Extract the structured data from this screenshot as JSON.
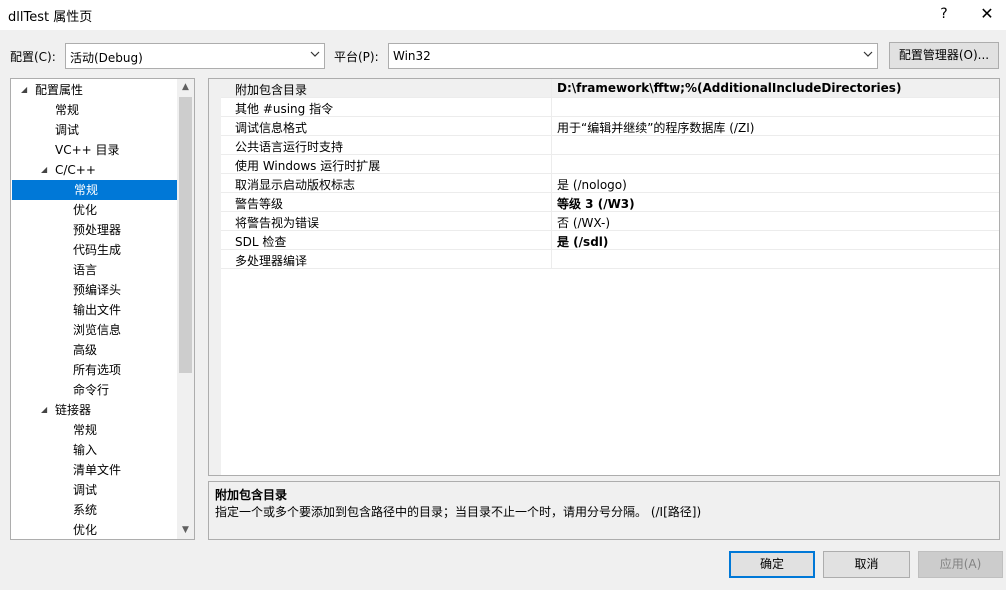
{
  "window": {
    "title": "dllTest 属性页",
    "help_label": "?",
    "close_label": "✕"
  },
  "config": {
    "label": "配置(C):",
    "value": "活动(Debug)"
  },
  "platform": {
    "label": "平台(P):",
    "value": "Win32"
  },
  "config_manager_label": "配置管理器(O)...",
  "tree": {
    "items": [
      {
        "label": "配置属性",
        "level": 0,
        "expanded": true
      },
      {
        "label": "常规",
        "level": 1
      },
      {
        "label": "调试",
        "level": 1
      },
      {
        "label": "VC++ 目录",
        "level": 1
      },
      {
        "label": "C/C++",
        "level": 1,
        "expanded": true
      },
      {
        "label": "常规",
        "level": 2,
        "selected": true
      },
      {
        "label": "优化",
        "level": 2
      },
      {
        "label": "预处理器",
        "level": 2
      },
      {
        "label": "代码生成",
        "level": 2
      },
      {
        "label": "语言",
        "level": 2
      },
      {
        "label": "预编译头",
        "level": 2
      },
      {
        "label": "输出文件",
        "level": 2
      },
      {
        "label": "浏览信息",
        "level": 2
      },
      {
        "label": "高级",
        "level": 2
      },
      {
        "label": "所有选项",
        "level": 2
      },
      {
        "label": "命令行",
        "level": 2
      },
      {
        "label": "链接器",
        "level": 1,
        "expanded": true
      },
      {
        "label": "常规",
        "level": 2
      },
      {
        "label": "输入",
        "level": 2
      },
      {
        "label": "清单文件",
        "level": 2
      },
      {
        "label": "调试",
        "level": 2
      },
      {
        "label": "系统",
        "level": 2
      },
      {
        "label": "优化",
        "level": 2
      }
    ],
    "expanded_arrow": "◢",
    "scroll_up": "▲",
    "scroll_down": "▼"
  },
  "properties": [
    {
      "name": "附加包含目录",
      "value": "D:\\framework\\fftw;%(AdditionalIncludeDirectories)",
      "bold": true,
      "selected": true
    },
    {
      "name": "其他 #using 指令",
      "value": ""
    },
    {
      "name": "调试信息格式",
      "value": "用于“编辑并继续”的程序数据库 (/ZI)"
    },
    {
      "name": "公共语言运行时支持",
      "value": ""
    },
    {
      "name": "使用 Windows 运行时扩展",
      "value": ""
    },
    {
      "name": "取消显示启动版权标志",
      "value": "是 (/nologo)"
    },
    {
      "name": "警告等级",
      "value": "等级 3 (/W3)",
      "bold": true
    },
    {
      "name": "将警告视为错误",
      "value": "否 (/WX-)"
    },
    {
      "name": "SDL 检查",
      "value": "是 (/sdl)",
      "bold": true
    },
    {
      "name": "多处理器编译",
      "value": ""
    }
  ],
  "description": {
    "title": "附加包含目录",
    "text": "指定一个或多个要添加到包含路径中的目录；当目录不止一个时，请用分号分隔。     (/I[路径])"
  },
  "buttons": {
    "ok": "确定",
    "cancel": "取消",
    "apply": "应用(A)"
  },
  "colors": {
    "selection": "#0078d7",
    "background": "#f0f0f0"
  }
}
